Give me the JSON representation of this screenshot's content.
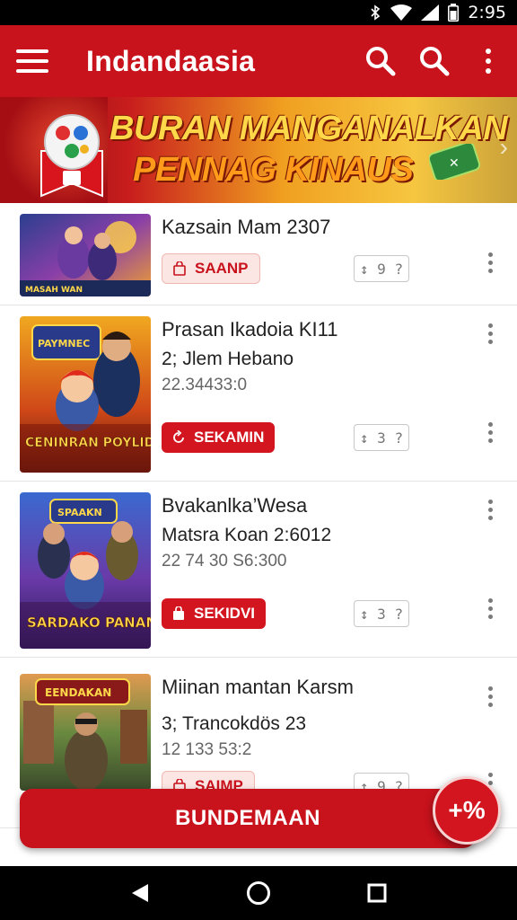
{
  "status_bar": {
    "time": "2:95",
    "icons": [
      "bluetooth-icon",
      "wifi-icon",
      "signal-icon",
      "battery-icon"
    ]
  },
  "app_bar": {
    "title": "Indandaasia",
    "icons": [
      "menu-icon",
      "search-icon",
      "search-icon",
      "more-vert-icon"
    ]
  },
  "banner": {
    "line1": "BURAN MANGANALKAN",
    "line2": "PENNAG KINAUS"
  },
  "items": [
    {
      "title": "Kazsain Mam 2307",
      "subtitle": "",
      "meta": "",
      "chip_label": "SAANP",
      "chip_style": "outline",
      "chip_icon": "bag-icon",
      "rating_text": "↕ 9 ?"
    },
    {
      "title": "Prasan Ikadoia KI11",
      "subtitle": "2; Jlem Hebano",
      "meta": "22.34433:0",
      "chip_label": "SEKAMIN",
      "chip_style": "solid",
      "chip_icon": "refresh-icon",
      "rating_text": "↕ 3 ?"
    },
    {
      "title": "Bvakanlka’Wesa",
      "subtitle": "Matsra Koan 2:6012",
      "meta": "22 74 30  S6:300",
      "chip_label": "SEKIDVI",
      "chip_style": "solid",
      "chip_icon": "bag-icon",
      "rating_text": "↕ 3 ?"
    },
    {
      "title": "Miinan mantan Karsm",
      "subtitle": "3; Trancokdös 23",
      "meta": "12 133 53:2",
      "chip_label": "SAIMP",
      "chip_style": "outline",
      "chip_icon": "bag-icon",
      "rating_text": "↕ 9 ?"
    }
  ],
  "thumbnails": [
    {
      "caption": "MASAH WAN"
    },
    {
      "caption_top": "PAYMNEC",
      "caption": "CENINRAN POYLIDOKAS"
    },
    {
      "caption_top": "SPAAKN",
      "caption": "SARDAKO PANAMIN"
    },
    {
      "caption_top": "EENDAKAN",
      "caption": ""
    }
  ],
  "action_button": {
    "label": "BUNDEMAAN"
  },
  "fab": {
    "label": "+%",
    "icon": "plus-percent-icon"
  },
  "nav_bar": {
    "icons": [
      "back-icon",
      "home-icon",
      "recents-icon"
    ]
  },
  "colors": {
    "primary": "#c8121c",
    "chip_outline_bg": "#fbe6e4",
    "banner_gold": "#ffd84a"
  }
}
